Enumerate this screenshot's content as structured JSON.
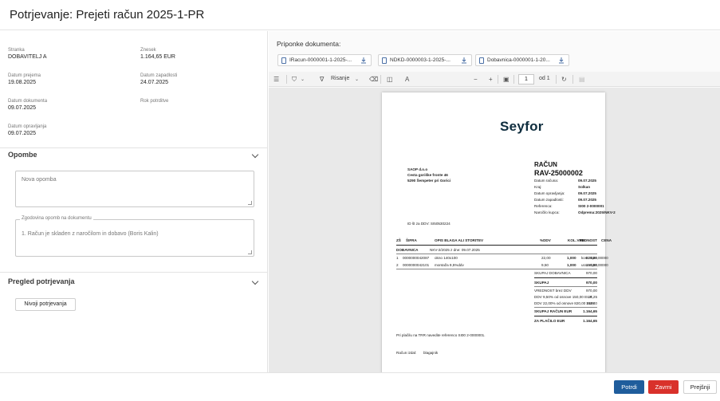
{
  "title": "Potrjevanje: Prejeti račun 2025-1-PR",
  "details": {
    "supplier_label": "Stranka",
    "supplier": "DOBAVITELJ A",
    "amount_label": "Znesek",
    "amount": "1.164,65 EUR",
    "received_label": "Datum prejema",
    "received": "19.08.2025",
    "due_label": "Datum zapadlosti",
    "due": "24.07.2025",
    "docdate_label": "Datum dokumenta",
    "docdate": "09.07.2025",
    "confirm_deadline_label": "Rok potrditve",
    "service_label": "Datum opravljanja",
    "service": "09.07.2025"
  },
  "notes": {
    "title": "Opombe",
    "new_placeholder": "Nova opomba",
    "history_label": "Zgodovina opomb na dokumentu",
    "history_text": "1. Račun je skladen z naročilom in dobavo (Boris Kalin)"
  },
  "approval": {
    "title": "Pregled potrjevanja",
    "levels_button": "Nivoji potrjevanja"
  },
  "attachments": {
    "title": "Priponke dokumenta:",
    "files": [
      "IRacun-0000001-1-2025-...",
      "NDKD-0000003-1-2025-...",
      "Dobavnica-0000001-1-20..."
    ]
  },
  "viewer_toolbar": {
    "draw_label": "Risanje",
    "page_value": "1",
    "page_of": "od 1"
  },
  "invoice": {
    "logo": "Seyfor",
    "seller": [
      "SAOP d.o.o",
      "Cesta goriške fronte 46",
      "5290 Šempeter pri Gorici"
    ],
    "vat_id": "ID št za DDV: SI50530224",
    "heading": "RAČUN",
    "number": "RAV-25000002",
    "meta_labels": [
      "Datum računa:",
      "Kraj:",
      "Datum opravljanja:",
      "Datum zapadlosti:",
      "Referenca:",
      "Naročilo kupca:"
    ],
    "meta_values": [
      "09.07.2025",
      "Solkan",
      "09.07.2025",
      "09.07.2025",
      "SI00 2-0000001",
      "Odprema:2025/NKV-2"
    ],
    "col_headers": [
      "ZŠ",
      "ŠIFRA",
      "OPIS BLAGA ALI STORITEV",
      "%DDV",
      "KOL.",
      "ME",
      "CENA",
      "VREDNOST"
    ],
    "group_label": "DOBAVNICA",
    "group_ref": "NKV-2/2025 z dne: 09.07.2025",
    "rows": [
      [
        "1",
        "0000000042087",
        "okno 140x100",
        "22,00",
        "1,000",
        "kos",
        "820,00000",
        "820,00"
      ],
      [
        "2",
        "0000000042101",
        "montaža 9,5%ddv",
        "9,50",
        "1,000",
        "ura",
        "150,00000",
        "150,00"
      ]
    ],
    "subtotal_label": "SKUPAJ DOBAVNICA",
    "subtotal": "970,00",
    "total_label": "SKUPAJ",
    "total": "970,00",
    "net_label": "VREDNOST brez DDV",
    "net": "970,00",
    "vat1_label": "DDV 9,50%   od osnove 150,00 EUR",
    "vat1": "14,25",
    "vat2_label": "DDV 22,00%   od osnove 820,00 EUR",
    "vat2": "180,40",
    "gross_label": "SKUPAJ RAČUN EUR",
    "gross": "1.164,65",
    "pay_label": "ZA PLAČILO EUR",
    "pay": "1.164,65",
    "payment_note": "Pri plačilu na TRR    navedite referenco SI00 2-0000001.",
    "issued_by_label": "Račun izdal:",
    "issued_by": "blagajnik"
  },
  "footer": {
    "confirm": "Potrdi",
    "reject": "Zavrni",
    "previous": "Prejšnji"
  },
  "colors": {
    "primary": "#1f5d9c",
    "danger": "#d9312b",
    "logo": "#0f2d3e"
  }
}
